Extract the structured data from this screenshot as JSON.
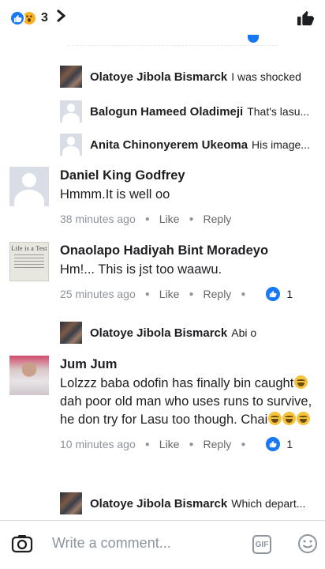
{
  "header": {
    "reaction_count": "3",
    "reaction_types": [
      "like",
      "wow"
    ],
    "chevron_icon": "chevron-right-icon",
    "like_icon": "thumbs-up-icon"
  },
  "comments": [
    {
      "type": "reply",
      "author": "Olatoye Jibola Bismarck",
      "text": "I was shocked",
      "avatar": "photo"
    },
    {
      "type": "reply",
      "author": "Balogun Hameed Oladimeji",
      "text": "That's lasu...",
      "avatar": "default"
    },
    {
      "type": "reply",
      "author": "Anita Chinonyerem Ukeoma",
      "text": "His image...",
      "avatar": "default"
    },
    {
      "type": "comment",
      "author": "Daniel King Godfrey",
      "text": "Hmmm.It is well oo",
      "time": "38 minutes ago",
      "like": "Like",
      "reply": "Reply",
      "avatar": "default"
    },
    {
      "type": "comment",
      "author": "Onaolapo Hadiyah Bint Moradeyo",
      "text": "Hm!... This is jst too waawu.",
      "time": "25 minutes ago",
      "like": "Like",
      "reply": "Reply",
      "reactions": "1",
      "avatar": "life-is-a-test",
      "avatar_title": "Life is a Test"
    },
    {
      "type": "reply",
      "author": "Olatoye Jibola Bismarck",
      "text": "Abi o",
      "avatar": "photo"
    },
    {
      "type": "comment",
      "author": "Jum Jum",
      "text_parts": [
        "Lolzzz baba odofin has finally bin caught",
        " dah poor old man who uses runs to survive, he don try for Lasu too though. Chai"
      ],
      "time": "10 minutes ago",
      "like": "Like",
      "reply": "Reply",
      "reactions": "1",
      "avatar": "photo-woman"
    },
    {
      "type": "reply",
      "author": "Olatoye Jibola Bismarck",
      "text": "Which depart...",
      "avatar": "photo"
    }
  ],
  "composer": {
    "placeholder": "Write a comment...",
    "camera_icon": "camera-icon",
    "gif_label": "GIF",
    "emoji_icon": "emoji-icon"
  },
  "colors": {
    "facebook_blue": "#1877f2",
    "wow_yellow": "#f7b125",
    "meta_gray": "#8d949e"
  }
}
